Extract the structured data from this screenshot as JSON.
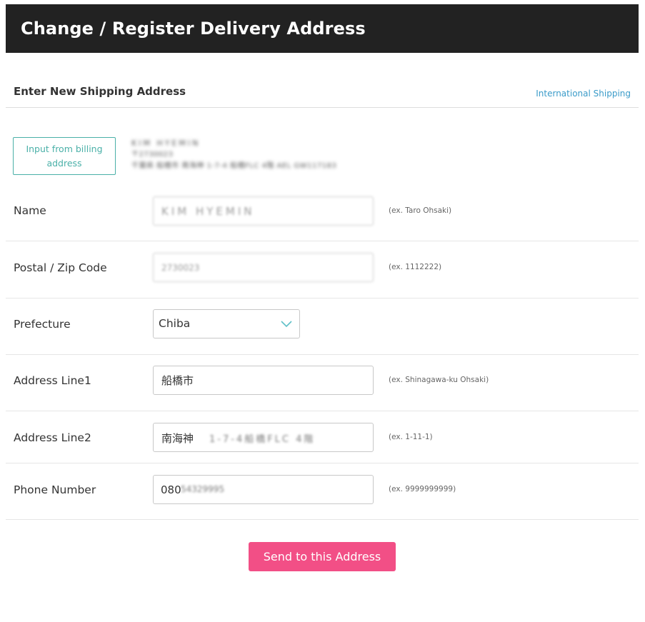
{
  "header": {
    "title": "Change / Register Delivery Address"
  },
  "section": {
    "title": "Enter New Shipping Address",
    "international_link": "International Shipping"
  },
  "billing": {
    "button_label": "Input from billing address",
    "info_line1": "KIM HYEMIN",
    "info_line2": "〒2730023",
    "info_line3": "千葉県 船橋市 南海神 1-7-4 船橋FLC 4階 AEL GW117183"
  },
  "form": {
    "name": {
      "label": "Name",
      "value": "KIM HYEMIN",
      "hint": "(ex. Taro Ohsaki)"
    },
    "postal": {
      "label": "Postal / Zip Code",
      "value": "2730023",
      "hint": "(ex. 1112222)"
    },
    "prefecture": {
      "label": "Prefecture",
      "value": "Chiba"
    },
    "address1": {
      "label": "Address Line1",
      "value": "船橋市",
      "hint": "(ex. Shinagawa-ku Ohsaki)"
    },
    "address2": {
      "label": "Address Line2",
      "value_visible": "南海神",
      "value_blurred": "1-7-4船橋FLC 4階",
      "hint": "(ex. 1-11-1)"
    },
    "phone": {
      "label": "Phone Number",
      "value_visible": "080",
      "value_blurred": "54329995",
      "hint": "(ex. 9999999999)"
    }
  },
  "submit": {
    "label": "Send to this Address"
  },
  "colors": {
    "header_bg": "#222222",
    "link": "#3a9bc9",
    "billing_button": "#4ab0a8",
    "submit_button": "#f24f86",
    "chevron": "#5fc0c8"
  },
  "icons": {
    "prefecture_dropdown": "chevron-down-icon"
  }
}
